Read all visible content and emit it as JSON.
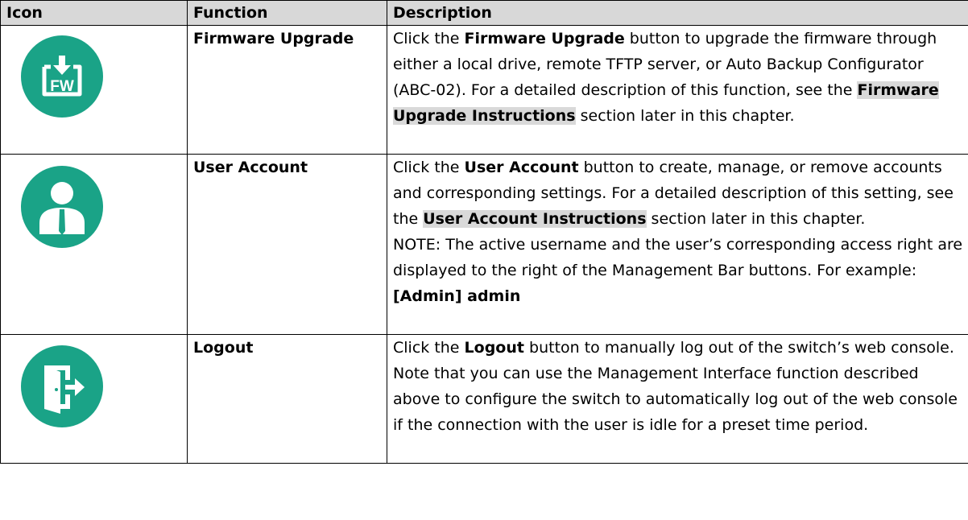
{
  "headers": {
    "icon": "Icon",
    "function": "Function",
    "description": "Description"
  },
  "rows": [
    {
      "icon": "firmware-upgrade-icon",
      "icon_text": "FW",
      "function": "Firmware Upgrade",
      "d1": "Click the ",
      "d2": "Firmware Upgrade",
      "d3": " button to upgrade the firmware through either a local drive, remote TFTP server, or Auto Backup Configurator (ABC-02). For a detailed description of this function, see the ",
      "d4": "Firmware Upgrade Instructions",
      "d5": " section later in this chapter."
    },
    {
      "icon": "user-account-icon",
      "function": "User Account",
      "d1": "Click the ",
      "d2": "User Account",
      "d3": " button to create, manage, or remove accounts and corresponding settings. For a detailed description of this setting, see the ",
      "d4": "User Account Instructions",
      "d5": " section later in this chapter.",
      "note": "NOTE: The active username and the user’s corresponding access right are displayed to the right of the Management Bar buttons. For example: ",
      "note_bold": "[Admin] admin"
    },
    {
      "icon": "logout-icon",
      "function": "Logout",
      "d1": "Click the ",
      "d2": "Logout",
      "d3": " button to manually log out of the switch’s web console. Note that you can use the Management Interface function described above to configure the switch to automatically log out of the web console if the connection with the user is idle for a preset time period."
    }
  ],
  "colors": {
    "icon_green": "#1aa387",
    "header_bg": "#d8d8d8",
    "highlight_bg": "#d9d9d9"
  }
}
